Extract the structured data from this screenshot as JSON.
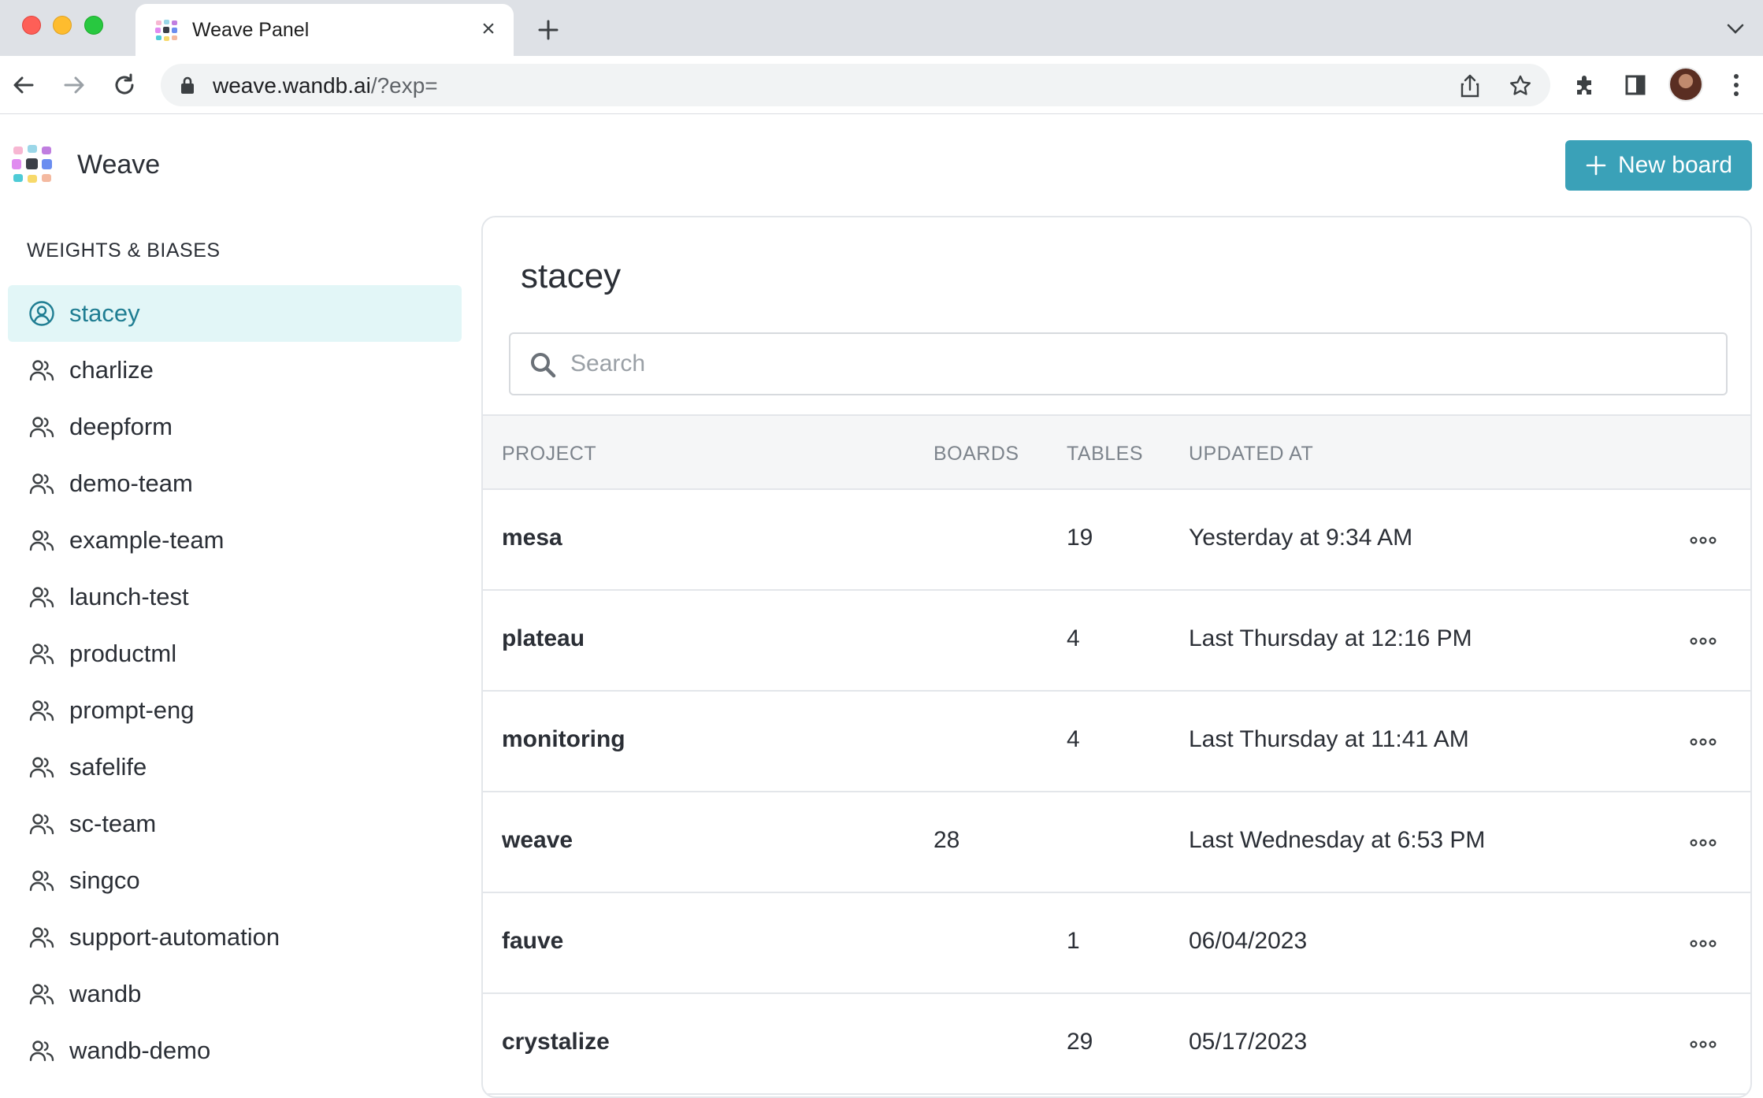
{
  "browser": {
    "tab_title": "Weave Panel",
    "url_host": "weave.wandb.ai",
    "url_path": "/?exp="
  },
  "app": {
    "name": "Weave",
    "new_board_label": "New board"
  },
  "sidebar": {
    "heading": "WEIGHTS & BIASES",
    "items": [
      {
        "label": "stacey",
        "icon": "user-circle-icon",
        "active": true
      },
      {
        "label": "charlize",
        "icon": "team-icon"
      },
      {
        "label": "deepform",
        "icon": "team-icon"
      },
      {
        "label": "demo-team",
        "icon": "team-icon"
      },
      {
        "label": "example-team",
        "icon": "team-icon"
      },
      {
        "label": "launch-test",
        "icon": "team-icon"
      },
      {
        "label": "productml",
        "icon": "team-icon"
      },
      {
        "label": "prompt-eng",
        "icon": "team-icon"
      },
      {
        "label": "safelife",
        "icon": "team-icon"
      },
      {
        "label": "sc-team",
        "icon": "team-icon"
      },
      {
        "label": "singco",
        "icon": "team-icon"
      },
      {
        "label": "support-automation",
        "icon": "team-icon"
      },
      {
        "label": "wandb",
        "icon": "team-icon"
      },
      {
        "label": "wandb-demo",
        "icon": "team-icon"
      }
    ]
  },
  "main": {
    "title": "stacey",
    "search_placeholder": "Search",
    "columns": {
      "project": "PROJECT",
      "boards": "BOARDS",
      "tables": "TABLES",
      "updated": "UPDATED AT"
    },
    "rows": [
      {
        "project": "mesa",
        "boards": "",
        "tables": "19",
        "updated": "Yesterday at 9:34 AM"
      },
      {
        "project": "plateau",
        "boards": "",
        "tables": "4",
        "updated": "Last Thursday at 12:16 PM"
      },
      {
        "project": "monitoring",
        "boards": "",
        "tables": "4",
        "updated": "Last Thursday at 11:41 AM"
      },
      {
        "project": "weave",
        "boards": "28",
        "tables": "",
        "updated": "Last Wednesday at 6:53 PM"
      },
      {
        "project": "fauve",
        "boards": "",
        "tables": "1",
        "updated": "06/04/2023"
      },
      {
        "project": "crystalize",
        "boards": "",
        "tables": "29",
        "updated": "05/17/2023"
      }
    ]
  },
  "colors": {
    "accent": "#3aa1b8",
    "active_bg": "#e2f6f7",
    "active_text": "#1f7d92"
  }
}
